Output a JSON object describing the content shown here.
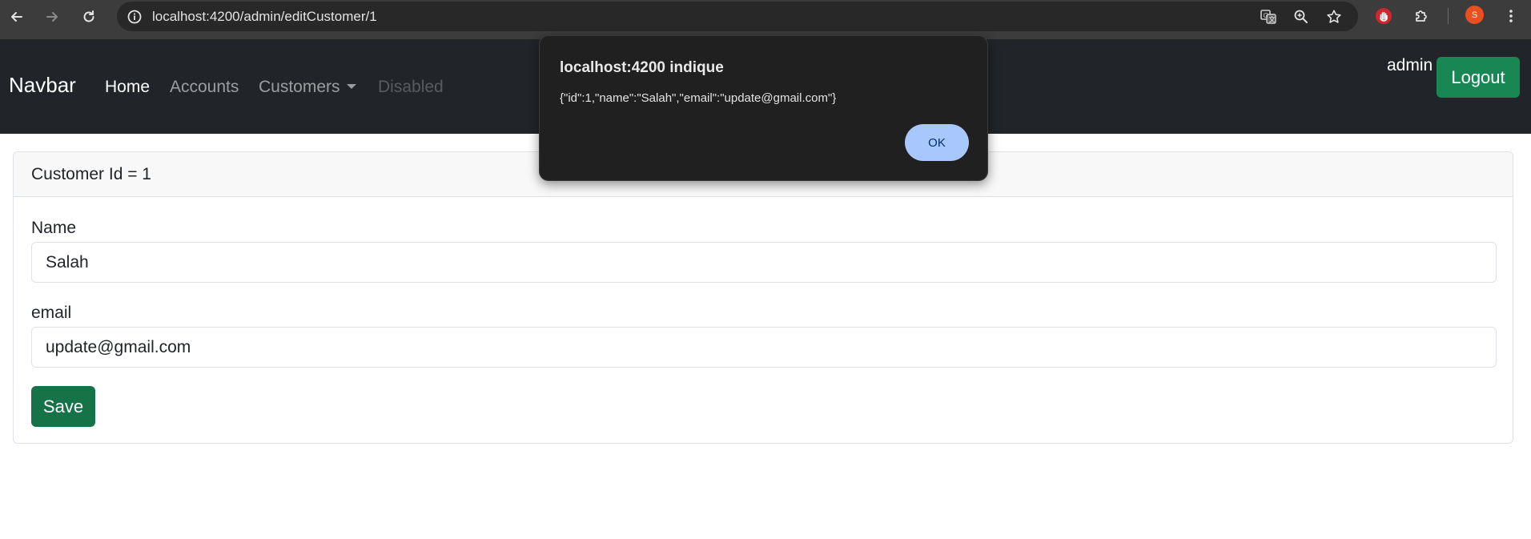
{
  "browser": {
    "url": "localhost:4200/admin/editCustomer/1",
    "profile_initial": "S",
    "icons": [
      "back-icon",
      "forward-icon",
      "reload-icon",
      "site-info-icon",
      "translate-icon",
      "zoom-icon",
      "bookmark-star-icon",
      "extension-hand-icon",
      "extensions-puzzle-icon",
      "kebab-menu-icon"
    ]
  },
  "navbar": {
    "brand": "Navbar",
    "links": [
      {
        "label": "Home",
        "state": "active"
      },
      {
        "label": "Accounts",
        "state": "normal"
      },
      {
        "label": "Customers",
        "state": "dropdown"
      },
      {
        "label": "Disabled",
        "state": "disabled"
      }
    ],
    "username": "admin",
    "logout_label": "Logout"
  },
  "card": {
    "header": "Customer Id = 1",
    "name_label": "Name",
    "name_value": "Salah",
    "email_label": "email",
    "email_value": "update@gmail.com",
    "save_label": "Save"
  },
  "dialog": {
    "title": "localhost:4200 indique",
    "message": "{\"id\":1,\"name\":\"Salah\",\"email\":\"update@gmail.com\"}",
    "ok_label": "OK"
  },
  "colors": {
    "chrome_bg": "#3c3c3c",
    "navbar_bg": "#212529",
    "success": "#198754",
    "dialog_bg": "#202020",
    "dialog_button": "#a8c7fa",
    "avatar": "#e8501e"
  }
}
